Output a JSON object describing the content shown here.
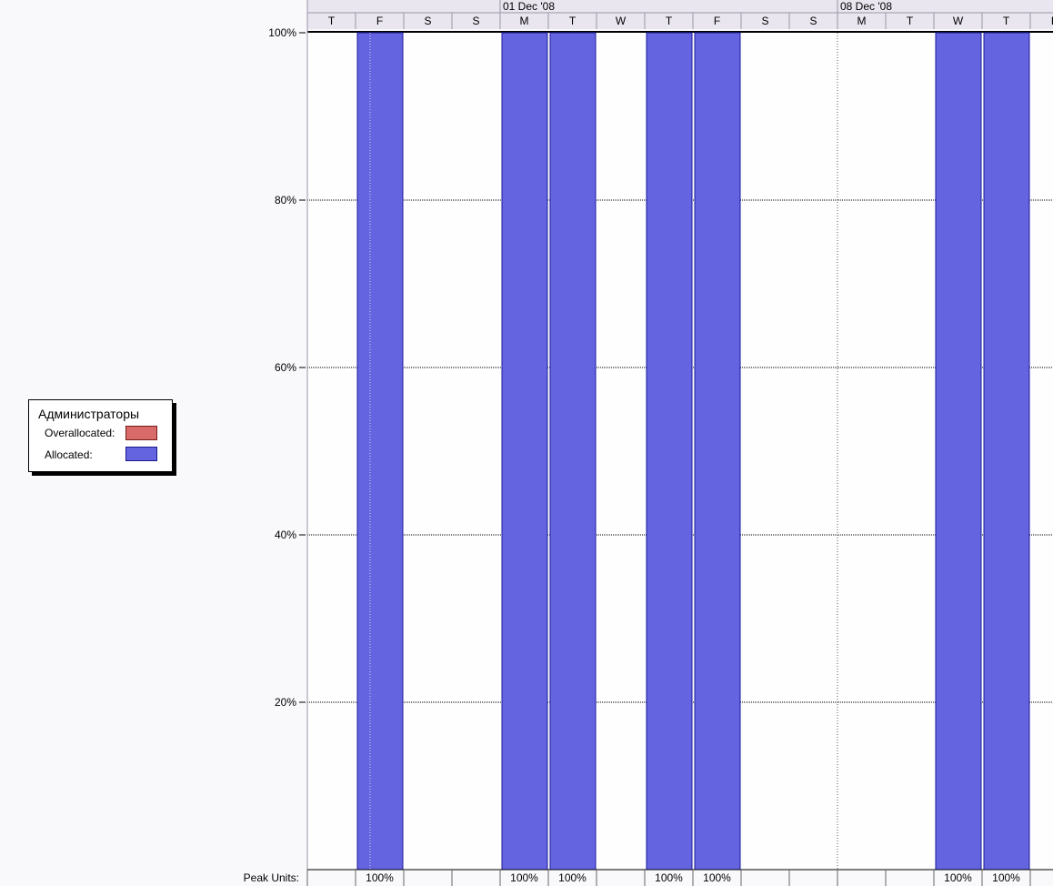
{
  "chart_data": {
    "type": "bar",
    "title": "Администраторы",
    "timescale_weeks": [
      "01 Dec '08",
      "08 Dec '08"
    ],
    "categories": [
      "T",
      "F",
      "S",
      "S",
      "M",
      "T",
      "W",
      "T",
      "F",
      "S",
      "S",
      "M",
      "T",
      "W",
      "T",
      "F"
    ],
    "series": [
      {
        "name": "Allocated:",
        "values": [
          0,
          100,
          0,
          0,
          100,
          100,
          0,
          100,
          100,
          0,
          0,
          0,
          0,
          100,
          100,
          0
        ]
      },
      {
        "name": "Overallocated:",
        "values": [
          0,
          0,
          0,
          0,
          0,
          0,
          0,
          0,
          0,
          0,
          0,
          0,
          0,
          0,
          0,
          0
        ]
      }
    ],
    "ylim": [
      0,
      100
    ],
    "yticks": [
      "20%",
      "40%",
      "60%",
      "80%",
      "100%"
    ],
    "grid": true,
    "peak_units_label": "Peak Units:",
    "peak_units": [
      "",
      "100%",
      "",
      "",
      "100%",
      "100%",
      "",
      "100%",
      "100%",
      "",
      "",
      "",
      "",
      "100%",
      "100%",
      ""
    ],
    "colors": {
      "allocated": "#6464e0",
      "overallocated": "#d86a6a",
      "grid": "#000000"
    }
  },
  "legend": {
    "title": "Администраторы",
    "overallocated_label": "Overallocated:",
    "allocated_label": "Allocated:"
  }
}
